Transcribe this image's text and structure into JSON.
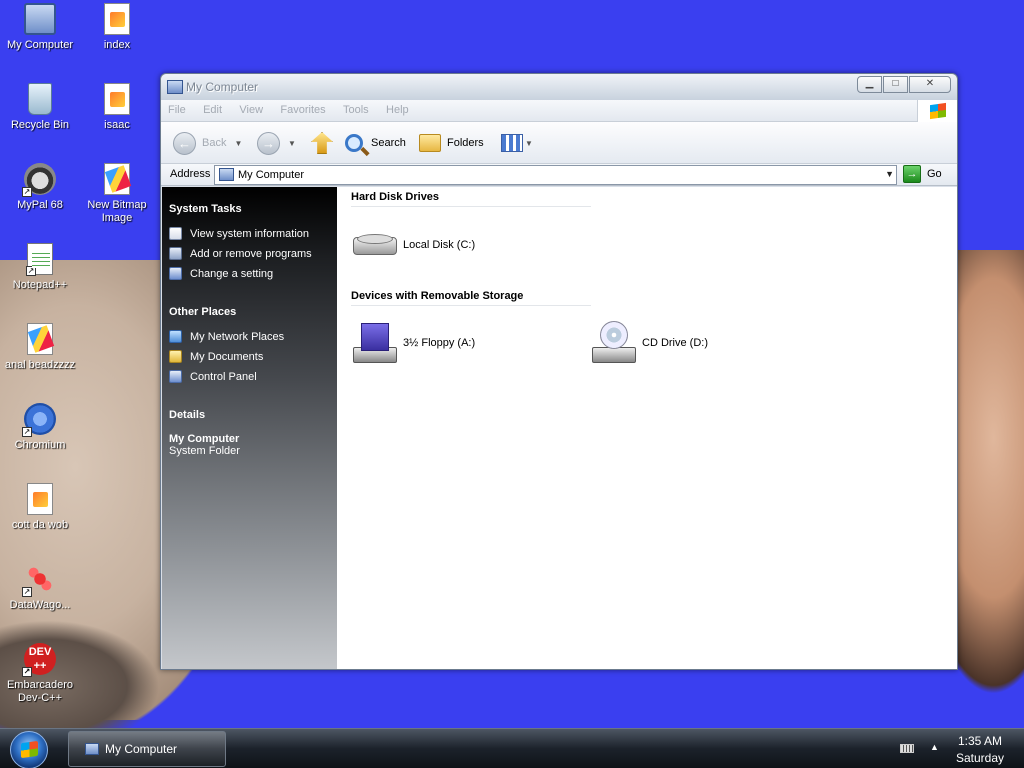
{
  "desktop": {
    "icons": [
      {
        "label": "My Computer",
        "icon": "my-computer-icon"
      },
      {
        "label": "index",
        "icon": "html-file-icon"
      },
      {
        "label": "Recycle Bin",
        "icon": "recycle-bin-icon"
      },
      {
        "label": "isaac",
        "icon": "html-file-icon"
      },
      {
        "label": "MyPal 68",
        "icon": "mypal-browser-icon"
      },
      {
        "label": "New Bitmap Image",
        "icon": "bitmap-image-icon"
      },
      {
        "label": "Notepad++",
        "icon": "notepad-plus-plus-icon"
      },
      {
        "label": "anal beadzzzz",
        "icon": "paint-brush-icon"
      },
      {
        "label": "Chromium",
        "icon": "chromium-icon"
      },
      {
        "label": "cott da wob",
        "icon": "html-file-icon"
      },
      {
        "label": "DataWago...",
        "icon": "datawagon-icon"
      },
      {
        "label": "Embarcadero Dev-C++",
        "icon": "dev-cpp-icon",
        "icon_text": "DEV\n++"
      }
    ]
  },
  "window": {
    "title": "My Computer",
    "buttons": {
      "minimize": "minimize",
      "maximize": "maximize",
      "close": "close"
    },
    "menu": [
      "File",
      "Edit",
      "View",
      "Favorites",
      "Tools",
      "Help"
    ],
    "toolbar": {
      "back_label": "Back",
      "search_label": "Search",
      "folders_label": "Folders"
    },
    "address": {
      "label": "Address",
      "value": "My Computer",
      "go_label": "Go"
    },
    "taskpane": {
      "system_tasks": {
        "heading": "System Tasks",
        "items": [
          "View system information",
          "Add or remove programs",
          "Change a setting"
        ]
      },
      "other_places": {
        "heading": "Other Places",
        "items": [
          "My Network Places",
          "My Documents",
          "Control Panel"
        ]
      },
      "details": {
        "heading": "Details",
        "name": "My Computer",
        "type": "System Folder"
      }
    },
    "groups": [
      {
        "heading": "Hard Disk Drives",
        "items": [
          "Local Disk (C:)"
        ]
      },
      {
        "heading": "Devices with Removable Storage",
        "items": [
          "3½ Floppy (A:)",
          "CD Drive (D:)"
        ]
      }
    ]
  },
  "taskbar": {
    "task_label": "My Computer",
    "time": "1:35 AM",
    "day": "Saturday"
  },
  "colors": {
    "desktop_background": "#3a3ff0",
    "taskpane_gradient_top": "#000000",
    "taskpane_gradient_bottom": "#c4c7cb"
  }
}
